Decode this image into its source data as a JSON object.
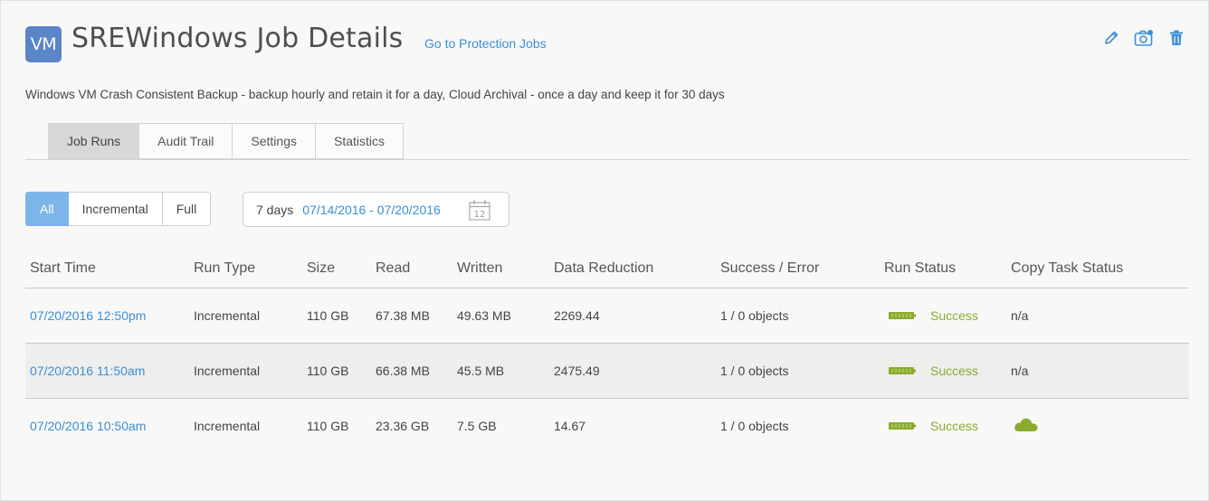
{
  "header": {
    "badge": "VM",
    "title": "SREWindows Job Details",
    "link": "Go to Protection Jobs",
    "actions": [
      "edit-icon",
      "camera-icon",
      "trash-icon"
    ]
  },
  "description": "Windows VM Crash Consistent Backup - backup hourly and retain it for a day, Cloud Archival - once a day and keep it for 30 days",
  "tabs": [
    {
      "label": "Job Runs",
      "active": true
    },
    {
      "label": "Audit Trail",
      "active": false
    },
    {
      "label": "Settings",
      "active": false
    },
    {
      "label": "Statistics",
      "active": false
    }
  ],
  "filters": {
    "segments": [
      {
        "label": "All",
        "active": true
      },
      {
        "label": "Incremental",
        "active": false
      },
      {
        "label": "Full",
        "active": false
      }
    ],
    "date_label": "7 days",
    "date_range": "07/14/2016 - 07/20/2016",
    "calendar_day": "12"
  },
  "table": {
    "columns": [
      "Start Time",
      "Run Type",
      "Size",
      "Read",
      "Written",
      "Data Reduction",
      "Success / Error",
      "Run Status",
      "Copy Task Status"
    ],
    "rows": [
      {
        "start": "07/20/2016 12:50pm",
        "type": "Incremental",
        "size": "110 GB",
        "read": "67.38 MB",
        "written": "49.63 MB",
        "reduction": "2269.44",
        "success": "1 / 0 objects",
        "status": "Success",
        "copy": "n/a"
      },
      {
        "start": "07/20/2016 11:50am",
        "type": "Incremental",
        "size": "110 GB",
        "read": "66.38 MB",
        "written": "45.5 MB",
        "reduction": "2475.49",
        "success": "1 / 0 objects",
        "status": "Success",
        "copy": "n/a"
      },
      {
        "start": "07/20/2016 10:50am",
        "type": "Incremental",
        "size": "110 GB",
        "read": "23.36 GB",
        "written": "7.5 GB",
        "reduction": "14.67",
        "success": "1 / 0 objects",
        "status": "Success",
        "copy": "",
        "copy_icon": "cloud-icon"
      }
    ]
  },
  "colors": {
    "accent": "#3a8fd6",
    "badge": "#5b85c9",
    "success": "#8bab2e",
    "segment_active": "#7db5ea"
  }
}
